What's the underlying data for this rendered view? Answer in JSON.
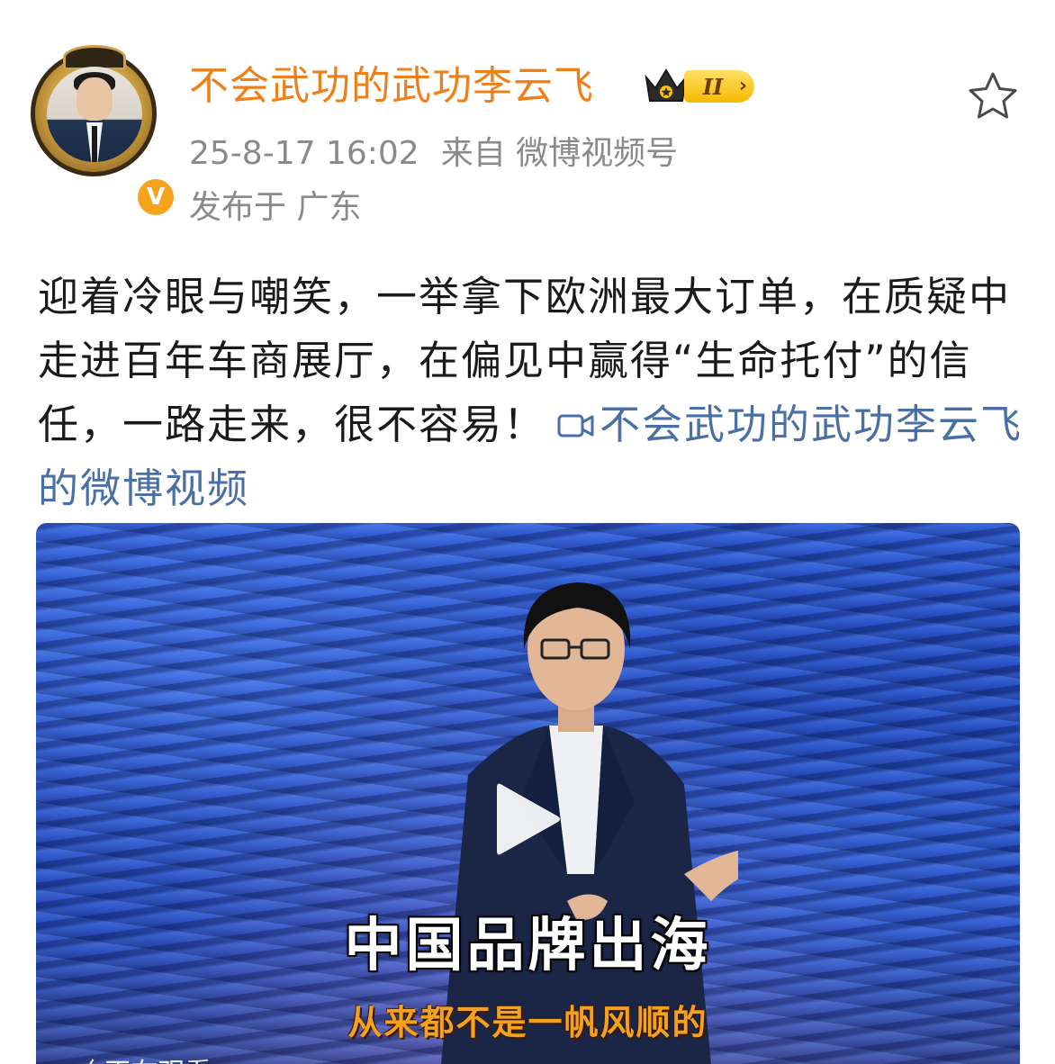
{
  "post": {
    "username": "不会武功的武功李云飞",
    "vip_level": "II",
    "timestamp": "25-8-17 16:02",
    "source_prefix": "来自",
    "source": "微博视频号",
    "location_prefix": "发布于",
    "location": "广东",
    "body_text": "迎着冷眼与嘲笑，一举拿下欧洲最大订单，在质疑中走进百年车商展厅，在偏见中赢得“生命托付”的信任，一路走来，很不容易！",
    "video_link_text": "不会武功的武功李云飞的微博视频"
  },
  "video": {
    "caption_main": "中国品牌出海",
    "caption_sub": "从来都不是一帆风顺的",
    "overlay_text": "〈 正在观看"
  },
  "icons": {
    "verified": "verified-v-icon",
    "vip": "crown-icon",
    "favorite": "star-outline-icon",
    "video_link": "video-camera-icon",
    "play": "play-icon"
  },
  "colors": {
    "username": "#ef7f1a",
    "meta": "#8a8a8a",
    "link": "#4a6fa5",
    "verified_badge": "#f7a31d",
    "caption_sub": "#f3a11f"
  }
}
